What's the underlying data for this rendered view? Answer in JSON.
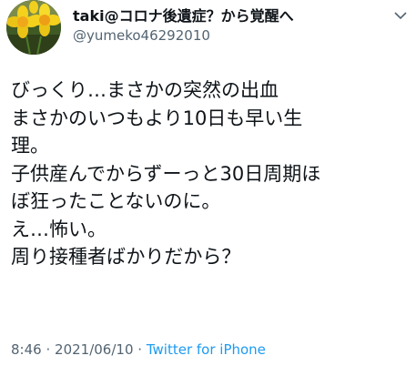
{
  "author": {
    "display_name": "taki@コロナ後遺症？から覚醒へ",
    "handle": "@yumeko46292010"
  },
  "tweet": {
    "lines": [
      "びっくり…まさかの突然の出血",
      "まさかのいつもより10日も早い生",
      "理。",
      "子供産んでからずーっと30日周期ほ",
      "ぼ狂ったことないのに。",
      "え…怖い。",
      "周り接種者ばかりだから？"
    ],
    "time": "8:46",
    "separator": "·",
    "date": "2021/06/10",
    "source": "Twitter for iPhone"
  },
  "icons": {
    "avatar": "daffodil-avatar-image",
    "more": "more-options-icon"
  },
  "colors": {
    "text": "#0f1419",
    "muted": "#536471",
    "link": "#1d9bf0"
  }
}
